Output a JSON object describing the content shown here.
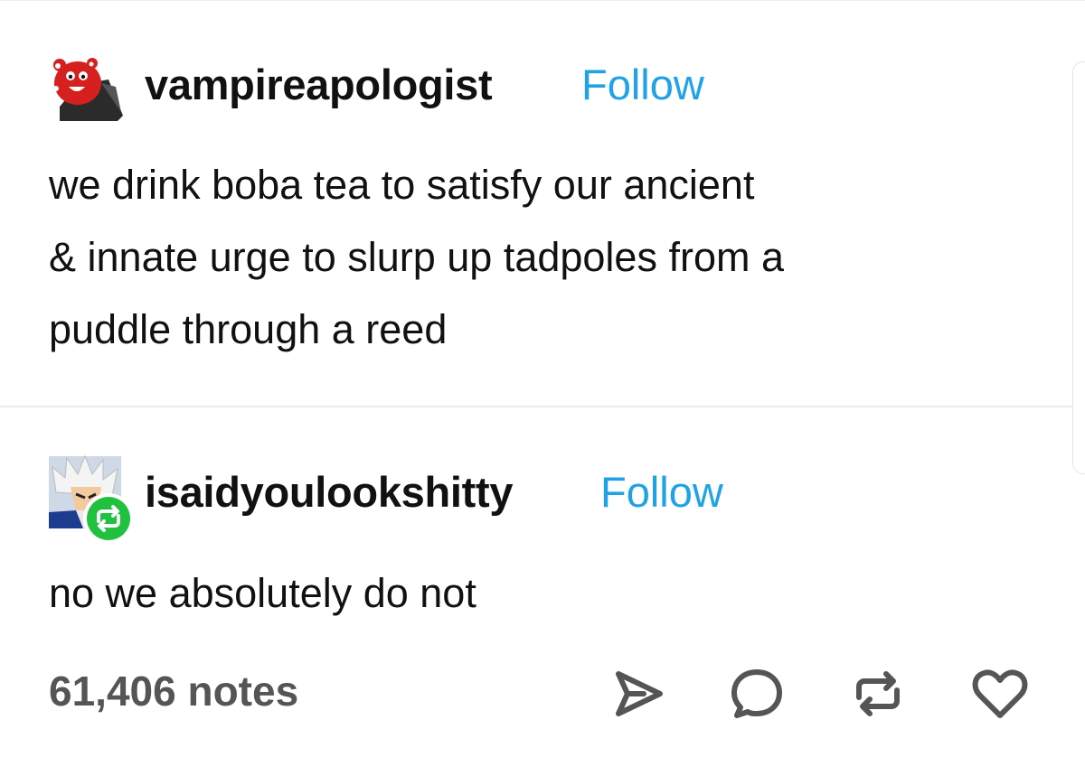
{
  "posts": [
    {
      "username": "vampireapologist",
      "follow_label": "Follow",
      "avatar_icon": "red-blob-vampire-avatar-icon",
      "lines": [
        "we drink boba tea to satisfy our ancient",
        "& innate urge to slurp up tadpoles from a",
        "puddle through a reed"
      ]
    },
    {
      "username": "isaidyoulookshitty",
      "follow_label": "Follow",
      "avatar_icon": "anime-character-avatar-icon",
      "badge_icon": "reblog-badge-icon",
      "lines": [
        "no we absolutely do not"
      ]
    }
  ],
  "footer": {
    "notes": "61,406 notes",
    "actions": [
      "share-icon",
      "reply-icon",
      "reblog-icon",
      "like-icon"
    ]
  },
  "colors": {
    "follow": "#1fa2e6",
    "reblog_badge": "#1fc13f",
    "notes": "#555555",
    "icons": "#555555"
  }
}
